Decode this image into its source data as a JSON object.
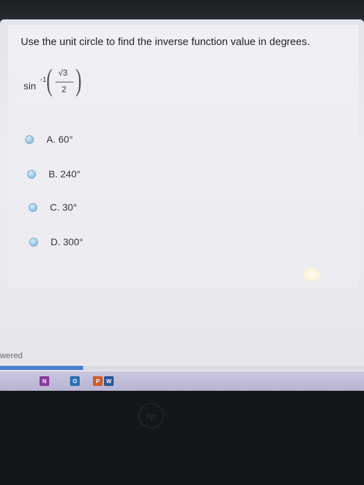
{
  "question": {
    "text": "Use the unit circle to find the inverse function value in degrees.",
    "expression": {
      "function": "sin",
      "exponent": "-1",
      "numerator": "√3",
      "denominator": "2"
    }
  },
  "choices": [
    {
      "label": "A.  60°"
    },
    {
      "label": "B.  240°"
    },
    {
      "label": "C.  30°"
    },
    {
      "label": "D.  300°"
    }
  ],
  "footer": {
    "status_text": "wered"
  },
  "colors": {
    "progress": "#4a7fcf",
    "radio": "#9dc9e6"
  },
  "taskbar": {
    "icons": [
      {
        "name": "onenote-icon",
        "letter": "N",
        "color": "#8a3aa0"
      },
      {
        "name": "outlook-icon",
        "letter": "O",
        "color": "#2a6fb7"
      },
      {
        "name": "powerpoint-icon",
        "letter": "P",
        "color": "#d25a2b"
      },
      {
        "name": "word-icon",
        "letter": "W",
        "color": "#2b579a"
      }
    ]
  },
  "logo": {
    "text": "hp"
  }
}
